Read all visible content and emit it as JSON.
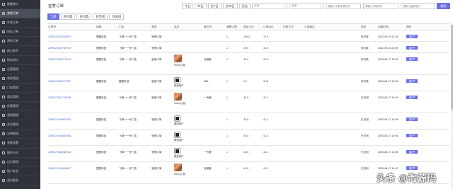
{
  "sidebar": {
    "items": [
      {
        "label": "数据统计"
      },
      {
        "label": "堂食订单"
      },
      {
        "label": "外卖订单"
      },
      {
        "label": "排队订单"
      },
      {
        "label": "预约订单"
      },
      {
        "label": "核心账号"
      },
      {
        "label": "财务统计"
      },
      {
        "label": "运营管理"
      },
      {
        "label": "商家管理"
      },
      {
        "label": "门店管理"
      },
      {
        "label": "商品管理"
      },
      {
        "label": "优惠管理"
      },
      {
        "label": "营销管理"
      },
      {
        "label": "会员管理"
      },
      {
        "label": "分销管理"
      },
      {
        "label": "系统设置"
      },
      {
        "label": "操作日志"
      },
      {
        "label": "后台管理"
      },
      {
        "label": "账户安全"
      },
      {
        "label": "退出登录"
      }
    ],
    "active_index": 1
  },
  "header": {
    "title": "堂食订单",
    "date_buttons": [
      "今日",
      "昨日",
      "近7日",
      "近30日",
      "历史"
    ],
    "store_select": "全部",
    "status_select": "全部",
    "order_input_placeholder": "请输入订单号/桌位号",
    "start_time_placeholder": "请输入开始时间",
    "end_time_placeholder": "请输入结束时间",
    "search_label": "搜索"
  },
  "tabs": [
    "全部",
    "待付款",
    "已付款",
    "已完成",
    "已关闭"
  ],
  "active_tab": 0,
  "columns": [
    "订单号",
    "商家",
    "门店",
    "类型",
    "会员",
    "桌位号",
    "就餐人数",
    "菜品小计",
    "订单合计",
    "付款方式",
    "订单备注",
    "状态",
    "创建时间",
    "操作"
  ],
  "rows": [
    {
      "order_no": "2209022235193670",
      "merchant": "盟图科技",
      "store": "飞烽一一号门店",
      "type": "堂食订单",
      "member_type": "",
      "member_name": "",
      "table": "",
      "people": "1",
      "subtotal": "100.0",
      "total": "71.0",
      "pay": "",
      "note": "",
      "status": "待付款",
      "created": "2022-09-02 22:18",
      "action": "操作"
    },
    {
      "order_no": "2209022209746739",
      "merchant": "盟图科技",
      "store": "飞烽一一号门店",
      "type": "堂食订单",
      "member_type": "",
      "member_name": "",
      "table": "",
      "people": "1",
      "subtotal": "40.0",
      "total": "41.0",
      "pay": "",
      "note": "",
      "status": "待付款",
      "created": "2022-09-02 22:09",
      "action": "操作"
    },
    {
      "order_no": "2008171549172078",
      "merchant": "盟图科技",
      "store": "飞烽一一号门店",
      "type": "堂食订单",
      "member_type": "photo",
      "member_name": "Sonny (测)",
      "table": "包厢桌",
      "people": "1",
      "subtotal": "30.2",
      "total": "31.2",
      "pay": "",
      "note": "",
      "status": "待付款",
      "created": "2020-08-17 15:49",
      "action": "操作"
    },
    {
      "order_no": "2008171538177467",
      "merchant": "盟图科技",
      "store": "盟图科技",
      "type": "堂食订单",
      "member_type": "qr",
      "member_name": "微信用户",
      "table": "B88",
      "people": "1",
      "subtotal": "0.2",
      "total": "3.15",
      "pay": "",
      "note": "",
      "status": "待付款",
      "created": "2020-08-17 15:38",
      "action": "操作"
    },
    {
      "order_no": "2008171501790578",
      "merchant": "盟图科技",
      "store": "飞烽一一号门店",
      "type": "堂食订单",
      "member_type": "photo",
      "member_name": "Sonny (测)",
      "table": "一号桌",
      "people": "1",
      "subtotal": "40.0",
      "total": "41.1",
      "pay": "",
      "note": "",
      "status": "已关闭",
      "created": "2020-08-17 15:01",
      "action": "操作"
    },
    {
      "order_no": "2008171459602325",
      "merchant": "盟图科技",
      "store": "飞烽一一号门店",
      "type": "堂食订单",
      "member_type": "qr",
      "member_name": "微信用户",
      "table": "",
      "people": "1",
      "subtotal": "40.0",
      "total": "41.1",
      "pay": "",
      "note": "",
      "status": "已关闭",
      "created": "2020-08-17 14:59",
      "action": "操作"
    },
    {
      "order_no": "2008171456430088",
      "merchant": "盟图科技",
      "store": "飞烽一一号门店",
      "type": "堂食订单",
      "member_type": "qr",
      "member_name": "微信用户",
      "table": "",
      "people": "1",
      "subtotal": "40.0",
      "total": "41.1",
      "pay": "",
      "note": "",
      "status": "已关闭",
      "created": "2020-08-17 14:56",
      "action": "操作"
    },
    {
      "order_no": "2008171455260246",
      "merchant": "盟图科技",
      "store": "飞烽一一号门店",
      "type": "堂食订单",
      "member_type": "qr",
      "member_name": "微信用户",
      "table": "一号桌",
      "people": "1",
      "subtotal": "40.0",
      "total": "41.1",
      "pay": "",
      "note": "",
      "status": "已关闭",
      "created": "2020-08-17 14:55",
      "action": "操作"
    },
    {
      "order_no": "2008171442480567",
      "merchant": "盟图科技",
      "store": "飞烽一一号门店",
      "type": "堂食订单",
      "member_type": "photo",
      "member_name": "Sonny (测)",
      "table": "包厢桌",
      "people": "1",
      "subtotal": "40.0",
      "total": "41.1",
      "pay": "",
      "note": "",
      "status": "已关闭",
      "created": "2020-08-17 14:42",
      "action": "操作"
    }
  ],
  "watermark": "头条 @淘源码",
  "colors": {
    "sidebar_bg": "#2f3339",
    "accent": "#6b70e6",
    "link": "#3d6cc6"
  }
}
